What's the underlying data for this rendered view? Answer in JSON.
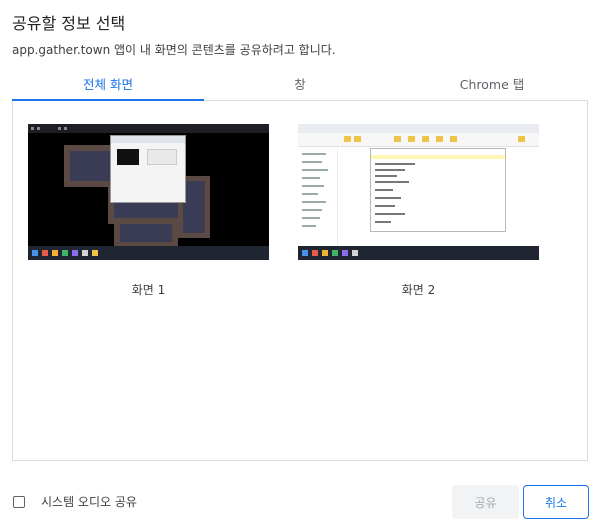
{
  "dialog": {
    "title": "공유할 정보 선택",
    "subtitle": "app.gather.town 앱이 내 화면의 콘텐츠를 공유하려고 합니다."
  },
  "tabs": [
    {
      "label": "전체 화면",
      "active": true
    },
    {
      "label": "창",
      "active": false
    },
    {
      "label": "Chrome 탭",
      "active": false
    }
  ],
  "screens": [
    {
      "label": "화면 1"
    },
    {
      "label": "화면 2"
    }
  ],
  "audio": {
    "label": "시스템 오디오 공유",
    "checked": false
  },
  "buttons": {
    "share": "공유",
    "cancel": "취소",
    "share_enabled": false
  },
  "colors": {
    "accent": "#1a73e8",
    "border": "#dadce0",
    "disabled_bg": "#f1f3f4"
  }
}
